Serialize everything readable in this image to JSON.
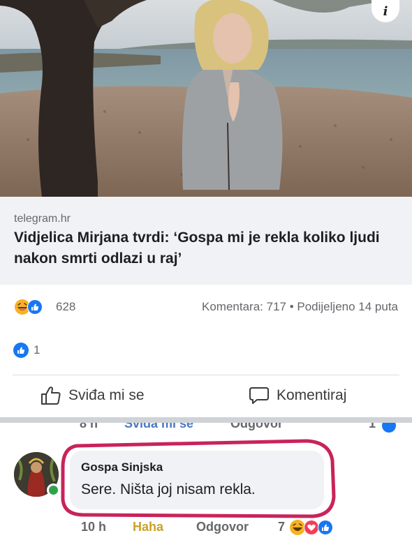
{
  "post": {
    "image": {
      "description_icon": "info-icon"
    },
    "info_label": "i",
    "link": {
      "source": "telegram.hr",
      "headline": "Vidjelica Mirjana tvrdi: ‘Gospa mi je rekla koliko ljudi nakon smrti odlazi u raj’"
    },
    "stats": {
      "reaction_count": "628",
      "comments_shares": "Komentara: 717 • Podijeljeno 14 puta"
    },
    "like_summary_count": "1",
    "actions": {
      "like_label": "Sviđa mi se",
      "comment_label": "Komentiraj"
    }
  },
  "cut_comment_footer": {
    "time": "8 h",
    "like": "Sviđa mi se",
    "reply": "Odgovor",
    "count": "1"
  },
  "comment": {
    "author": "Gospa Sinjska",
    "text": "Sere. Ništa joj nisam rekla.",
    "time": "10 h",
    "haha": "Haha",
    "reply": "Odgovor",
    "reaction_count": "7"
  },
  "colors": {
    "haha": "#c9a227",
    "like_blue": "#1877f2",
    "love_red": "#f33e58",
    "online": "#31a24c"
  }
}
